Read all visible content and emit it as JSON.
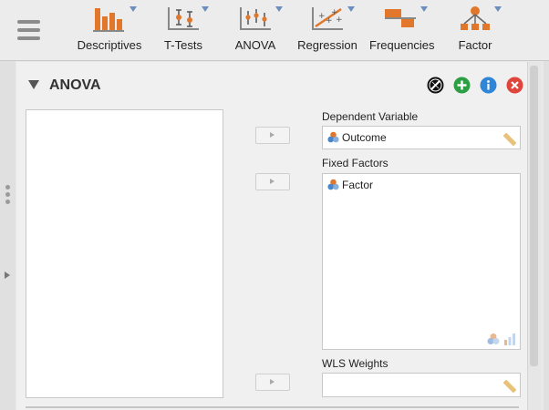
{
  "ribbon": {
    "items": [
      {
        "label": "Descriptives",
        "icon": "descriptives-icon"
      },
      {
        "label": "T-Tests",
        "icon": "t-tests-icon"
      },
      {
        "label": "ANOVA",
        "icon": "anova-icon"
      },
      {
        "label": "Regression",
        "icon": "regression-icon"
      },
      {
        "label": "Frequencies",
        "icon": "frequencies-icon"
      },
      {
        "label": "Factor",
        "icon": "factor-icon"
      }
    ]
  },
  "analysis": {
    "title": "ANOVA",
    "buttons": [
      "edit-icon",
      "add-icon",
      "info-icon",
      "close-icon"
    ]
  },
  "dependent": {
    "label": "Dependent Variable",
    "value": "Outcome"
  },
  "fixed_factors": {
    "label": "Fixed Factors",
    "items": [
      "Factor"
    ]
  },
  "wls": {
    "label": "WLS Weights",
    "value": ""
  },
  "colors": {
    "ribbon_icon_orange": "#e0772b",
    "ribbon_caret_blue": "#6c8ebf",
    "add_green": "#2e9e44",
    "info_blue": "#2f86d6",
    "close_red": "#e0453b"
  }
}
